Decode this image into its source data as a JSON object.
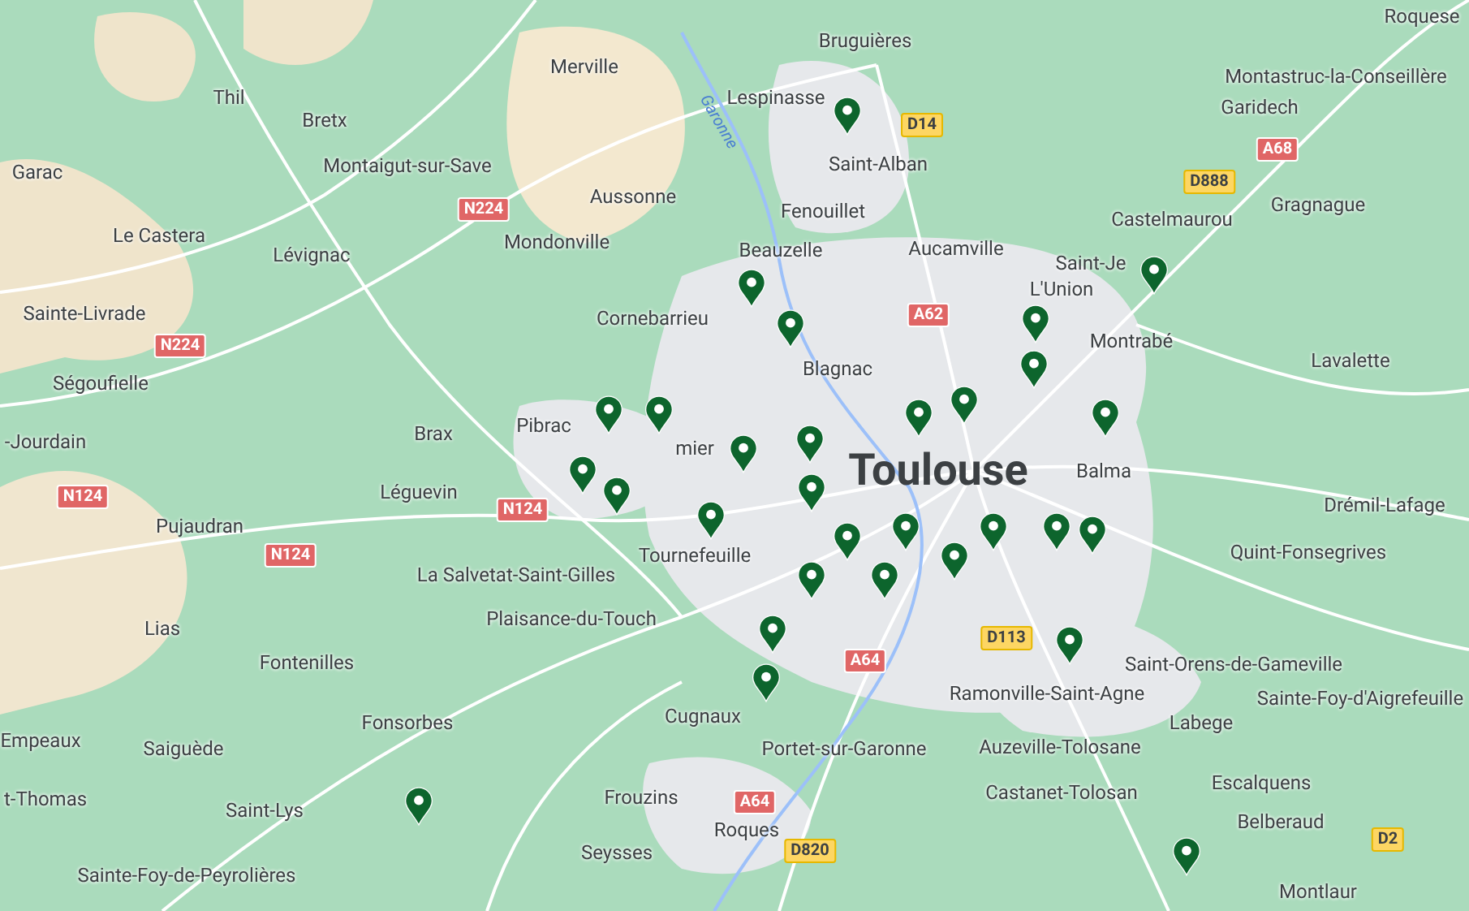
{
  "places": [
    {
      "name": "Merville",
      "kind": "town"
    },
    {
      "name": "Bruguières",
      "kind": "town"
    },
    {
      "name": "Lespinasse",
      "kind": "town"
    },
    {
      "name": "Saint-Alban",
      "kind": "town"
    },
    {
      "name": "Fenouillet",
      "kind": "town"
    },
    {
      "name": "Thil",
      "kind": "town"
    },
    {
      "name": "Bretx",
      "kind": "town"
    },
    {
      "name": "Montaigut-sur-Save",
      "kind": "town"
    },
    {
      "name": "Aussonne",
      "kind": "town"
    },
    {
      "name": "Garac",
      "kind": "town"
    },
    {
      "name": "Le Castera",
      "kind": "town"
    },
    {
      "name": "Lévignac",
      "kind": "town"
    },
    {
      "name": "Mondonville",
      "kind": "town"
    },
    {
      "name": "Beauzelle",
      "kind": "town"
    },
    {
      "name": "Aucamville",
      "kind": "town"
    },
    {
      "name": "Cornebarrieu",
      "kind": "town"
    },
    {
      "name": "Sainte-Livrade",
      "kind": "town"
    },
    {
      "name": "Ségoufielle",
      "kind": "town"
    },
    {
      "name": "Blagnac",
      "kind": "town"
    },
    {
      "name": "Brax",
      "kind": "town"
    },
    {
      "name": "Pibrac",
      "kind": "town"
    },
    {
      "name": "mier",
      "kind": "town"
    },
    {
      "name": "-Jourdain",
      "kind": "town"
    },
    {
      "name": "Léguevin",
      "kind": "town"
    },
    {
      "name": "Pujaudran",
      "kind": "town"
    },
    {
      "name": "Tournefeuille",
      "kind": "town"
    },
    {
      "name": "La Salvetat-Saint-Gilles",
      "kind": "town"
    },
    {
      "name": "Lias",
      "kind": "town"
    },
    {
      "name": "Plaisance-du-Touch",
      "kind": "town"
    },
    {
      "name": "Fontenilles",
      "kind": "town"
    },
    {
      "name": "Fonsorbes",
      "kind": "town"
    },
    {
      "name": "Cugnaux",
      "kind": "town"
    },
    {
      "name": "Empeaux",
      "kind": "town"
    },
    {
      "name": "Saiguède",
      "kind": "town"
    },
    {
      "name": "Portet-sur-Garonne",
      "kind": "town"
    },
    {
      "name": "t-Thomas",
      "kind": "town"
    },
    {
      "name": "Saint-Lys",
      "kind": "town"
    },
    {
      "name": "Frouzins",
      "kind": "town"
    },
    {
      "name": "Seysses",
      "kind": "town"
    },
    {
      "name": "Roques",
      "kind": "town"
    },
    {
      "name": "Sainte-Foy-de-Peyrolières",
      "kind": "town"
    },
    {
      "name": "Roquese",
      "kind": "town"
    },
    {
      "name": "Montastruc-la-Conseillère",
      "kind": "town"
    },
    {
      "name": "Garidech",
      "kind": "town"
    },
    {
      "name": "Gragnague",
      "kind": "town"
    },
    {
      "name": "Castelmaurou",
      "kind": "town"
    },
    {
      "name": "Saint-Je",
      "kind": "town"
    },
    {
      "name": "L'Union",
      "kind": "town"
    },
    {
      "name": "Montrabé",
      "kind": "town"
    },
    {
      "name": "Lavalette",
      "kind": "town"
    },
    {
      "name": "Toulouse",
      "kind": "city"
    },
    {
      "name": "Balma",
      "kind": "town"
    },
    {
      "name": "Drémil-Lafage",
      "kind": "town"
    },
    {
      "name": "Quint-Fonsegrives",
      "kind": "town"
    },
    {
      "name": "Saint-Orens-de-Gameville",
      "kind": "town"
    },
    {
      "name": "Ramonville-Saint-Agne",
      "kind": "town"
    },
    {
      "name": "Sainte-Foy-d'Aigrefeuille",
      "kind": "town"
    },
    {
      "name": "Labege",
      "kind": "town"
    },
    {
      "name": "Auzeville-Tolosane",
      "kind": "town"
    },
    {
      "name": "Castanet-Tolosan",
      "kind": "town"
    },
    {
      "name": "Escalquens",
      "kind": "town"
    },
    {
      "name": "Belberaud",
      "kind": "town"
    },
    {
      "name": "Montlaur",
      "kind": "town"
    },
    {
      "name": "Garonne",
      "kind": "river"
    }
  ],
  "road_shields": [
    {
      "label": "D14",
      "kind": "departmental"
    },
    {
      "label": "A62",
      "kind": "motorway"
    },
    {
      "label": "A68",
      "kind": "motorway"
    },
    {
      "label": "D888",
      "kind": "departmental"
    },
    {
      "label": "N224",
      "kind": "motorway"
    },
    {
      "label": "N224",
      "kind": "motorway"
    },
    {
      "label": "N124",
      "kind": "motorway"
    },
    {
      "label": "N124",
      "kind": "motorway"
    },
    {
      "label": "N124",
      "kind": "motorway"
    },
    {
      "label": "A64",
      "kind": "motorway"
    },
    {
      "label": "A64",
      "kind": "motorway"
    },
    {
      "label": "D113",
      "kind": "departmental"
    },
    {
      "label": "D820",
      "kind": "departmental"
    },
    {
      "label": "D2",
      "kind": "departmental"
    }
  ]
}
